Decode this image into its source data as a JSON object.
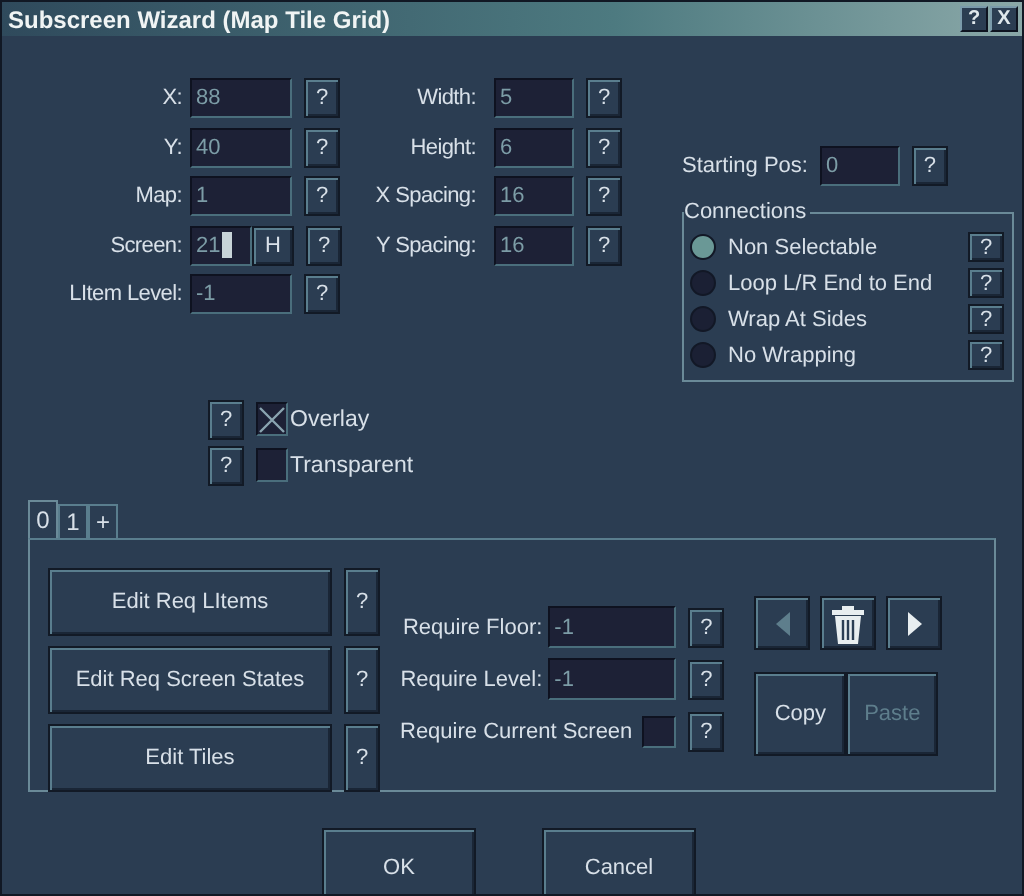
{
  "window": {
    "title": "Subscreen Wizard (Map Tile Grid)",
    "buttons": [
      "?",
      "X"
    ]
  },
  "fields_left": [
    {
      "label": "X:",
      "value": "88",
      "focused": false,
      "help": "?"
    },
    {
      "label": "Y:",
      "value": "40",
      "focused": false,
      "help": "?"
    },
    {
      "label": "Map:",
      "value": "1",
      "focused": false,
      "help": "?"
    },
    {
      "label": "Screen:",
      "value": "21",
      "focused": true,
      "extra_button": "H",
      "help": "?"
    },
    {
      "label": "LItem Level:",
      "value": "-1",
      "focused": false,
      "help": "?"
    }
  ],
  "fields_right": [
    {
      "label": "Width:",
      "value": "5",
      "help": "?"
    },
    {
      "label": "Height:",
      "value": "6",
      "help": "?"
    },
    {
      "label": "X Spacing:",
      "value": "16",
      "help": "?"
    },
    {
      "label": "Y Spacing:",
      "value": "16",
      "help": "?"
    }
  ],
  "checkboxes": [
    {
      "label": "Overlay",
      "checked": true,
      "help": "?"
    },
    {
      "label": "Transparent",
      "checked": false,
      "help": "?"
    }
  ],
  "starting_pos": {
    "label": "Starting Pos:",
    "value": "0",
    "help": "?"
  },
  "connections": {
    "title": "Connections",
    "options": [
      {
        "label": "Non Selectable",
        "selected": true,
        "help": "?"
      },
      {
        "label": "Loop L/R End to End",
        "selected": false,
        "help": "?"
      },
      {
        "label": "Wrap At Sides",
        "selected": false,
        "help": "?"
      },
      {
        "label": "No Wrapping",
        "selected": false,
        "help": "?"
      }
    ]
  },
  "tabs": [
    {
      "label": "0",
      "selected": true
    },
    {
      "label": "1",
      "selected": false
    },
    {
      "label": "+",
      "selected": false
    }
  ],
  "tab_panel": {
    "edit_buttons": [
      {
        "label": "Edit Req LItems",
        "help": "?"
      },
      {
        "label": "Edit Req Screen States",
        "help": "?"
      },
      {
        "label": "Edit Tiles",
        "help": "?"
      }
    ],
    "requirements": [
      {
        "kind": "field",
        "label": "Require Floor:",
        "value": "-1",
        "help": "?"
      },
      {
        "kind": "field",
        "label": "Require Level:",
        "value": "-1",
        "help": "?"
      },
      {
        "kind": "checkbox",
        "label": "Require Current Screen",
        "checked": false,
        "help": "?"
      }
    ],
    "nav": [
      {
        "kind": "prev",
        "disabled": true
      },
      {
        "kind": "delete",
        "disabled": false
      },
      {
        "kind": "next",
        "disabled": false
      }
    ],
    "clipboard": [
      {
        "label": "Copy",
        "disabled": false
      },
      {
        "label": "Paste",
        "disabled": true
      }
    ]
  },
  "buttons": [
    "OK",
    "Cancel"
  ]
}
